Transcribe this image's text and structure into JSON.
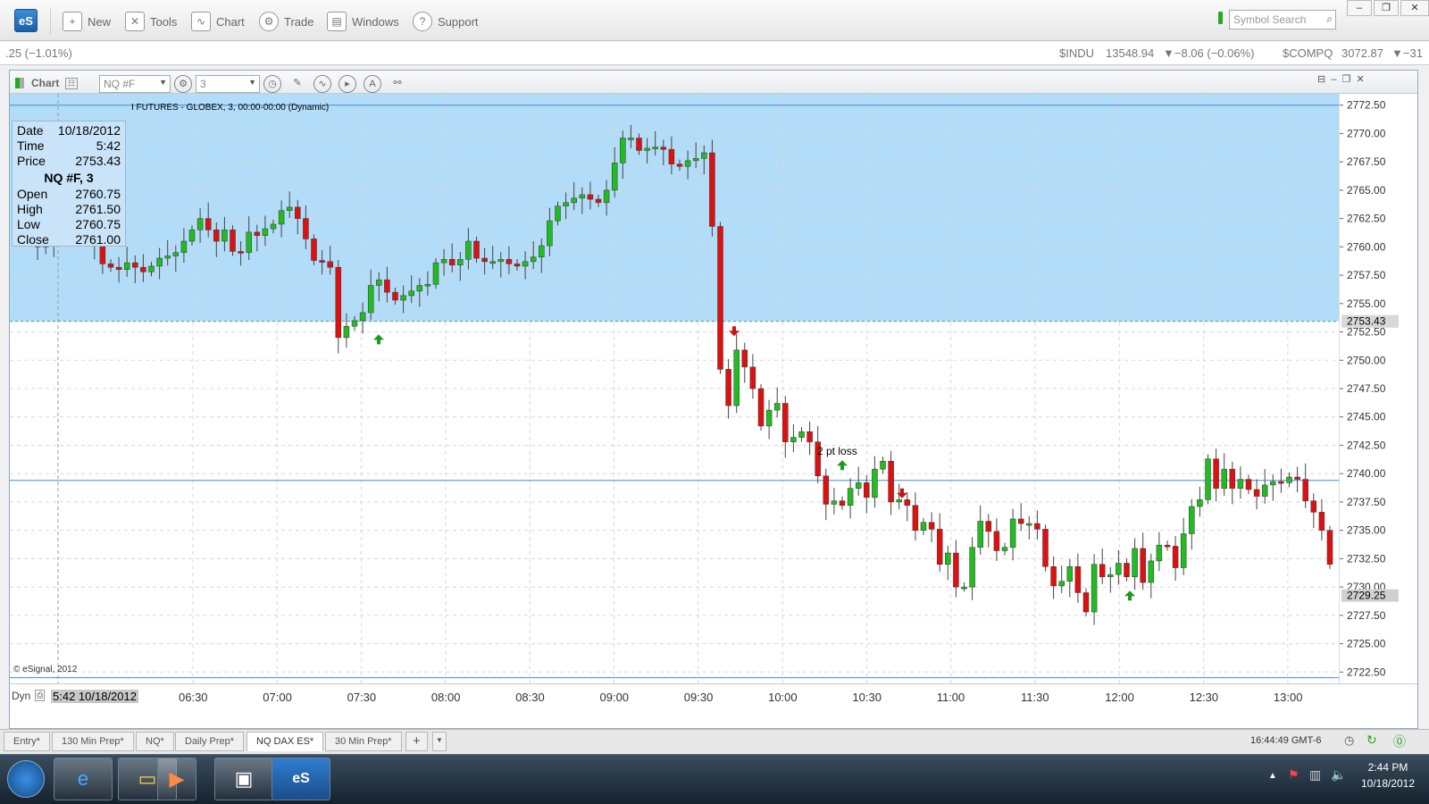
{
  "app": {
    "logo": "eS"
  },
  "toolbar": {
    "new": "New",
    "tools": "Tools",
    "chart": "Chart",
    "trade": "Trade",
    "windows": "Windows",
    "support": "Support",
    "symbol_search_placeholder": "Symbol Search"
  },
  "ticker": {
    "left_change": ".25 (−1.01%)",
    "indu_sym": "$INDU",
    "indu_price": "13548.94",
    "indu_change": "▼−8.06 (−0.06%)",
    "comp_sym": "$COMPQ",
    "comp_price": "3072.87",
    "comp_change": "▼−31"
  },
  "chart_window": {
    "title": "Chart",
    "symbol": "NQ #F",
    "interval": "3",
    "subtitle": "I FUTURES - GLOBEX, 3, 00:00-00:00 (Dynamic)",
    "copyright": "© eSignal, 2012",
    "mode": "Dyn",
    "cursor_time": "5:42 10/18/2012"
  },
  "info_box": {
    "date_label": "Date",
    "date": "10/18/2012",
    "time_label": "Time",
    "time": "5:42",
    "price_label": "Price",
    "price": "2753.43",
    "title": "NQ #F, 3",
    "open_label": "Open",
    "open": "2760.75",
    "high_label": "High",
    "high": "2761.50",
    "low_label": "Low",
    "low": "2760.75",
    "close_label": "Close",
    "close": "2761.00"
  },
  "annotations": {
    "loss_label": "2 pt loss"
  },
  "colors": {
    "bull": "#22bb22",
    "bear": "#dd1111",
    "band": "#b3dcf8",
    "line": "#3a8fd8"
  },
  "chart_data": {
    "type": "candlestick",
    "title": "",
    "symbol": "NQ #F",
    "interval_minutes": 3,
    "ylim": [
      2721.5,
      2773.5
    ],
    "y_ticks": [
      "2772.50",
      "2770.00",
      "2767.50",
      "2765.00",
      "2762.50",
      "2760.00",
      "2757.50",
      "2755.00",
      "2752.50",
      "2750.00",
      "2747.50",
      "2745.00",
      "2742.50",
      "2740.00",
      "2737.50",
      "2735.00",
      "2732.50",
      "2730.00",
      "2727.50",
      "2725.00",
      "2722.50"
    ],
    "x_ticks": [
      "06:30",
      "07:00",
      "07:30",
      "08:00",
      "08:30",
      "09:00",
      "09:30",
      "10:00",
      "10:30",
      "11:00",
      "11:30",
      "12:00",
      "12:30",
      "13:00"
    ],
    "cursor_price": "2753.43",
    "last_price": "2729.25",
    "shaded_band": [
      2753.43,
      2773.5
    ],
    "horizontal_lines": [
      2739.4,
      2772.5,
      2722.0
    ],
    "closes": [
      2762,
      2760,
      2760.5,
      2761,
      2761.3,
      2761.5,
      2762,
      2761.8,
      2760.3,
      2758.5,
      2758.2,
      2758,
      2758.6,
      2758.2,
      2757.8,
      2758.3,
      2759,
      2759.2,
      2759.5,
      2760.5,
      2761.5,
      2762.5,
      2761.5,
      2760.5,
      2761.5,
      2759.6,
      2759.5,
      2761.3,
      2761,
      2761.6,
      2762,
      2763.2,
      2763.5,
      2762.5,
      2760.7,
      2758.8,
      2758.7,
      2758.2,
      2752,
      2753,
      2753.5,
      2754.2,
      2756.6,
      2757.1,
      2756,
      2755.3,
      2755.7,
      2756.1,
      2756.6,
      2756.7,
      2758.6,
      2758.9,
      2758.4,
      2758.9,
      2760.5,
      2759,
      2758.7,
      2758.7,
      2758.9,
      2758.5,
      2758.3,
      2758.7,
      2759.1,
      2760.1,
      2762.3,
      2763.6,
      2763.9,
      2764.3,
      2764.6,
      2764.2,
      2763.9,
      2765,
      2767.4,
      2769.6,
      2769.6,
      2768.5,
      2768.7,
      2768.8,
      2768.6,
      2767.3,
      2767.1,
      2767.6,
      2767.8,
      2768.3,
      2761.8,
      2749.2,
      2746,
      2750.9,
      2749.4,
      2747.5,
      2744.2,
      2745.6,
      2746.2,
      2742.8,
      2743.2,
      2743.7,
      2742.8,
      2739.8,
      2737.3,
      2737.6,
      2737.2,
      2738.7,
      2739.2,
      2737.9,
      2740.4,
      2741.1,
      2737.5,
      2737.7,
      2737.2,
      2735,
      2735.7,
      2735.1,
      2732,
      2733,
      2730,
      2730,
      2733.5,
      2735.8,
      2734.9,
      2733.2,
      2733.5,
      2736,
      2735.6,
      2735.6,
      2735.1,
      2731.8,
      2730.1,
      2730.5,
      2731.8,
      2729.5,
      2727.8,
      2732,
      2730.9,
      2731.1,
      2732.1,
      2730.9,
      2733.4,
      2730.4,
      2732.3,
      2733.7,
      2733.6,
      2731.7,
      2734.7,
      2737.1,
      2737.7,
      2741.3,
      2738.7,
      2740.4,
      2738.7,
      2739.5,
      2738.6,
      2738,
      2739,
      2739.3,
      2739.2,
      2739.7,
      2739.5,
      2737.6,
      2736.6,
      2735,
      2732
    ]
  }
}
